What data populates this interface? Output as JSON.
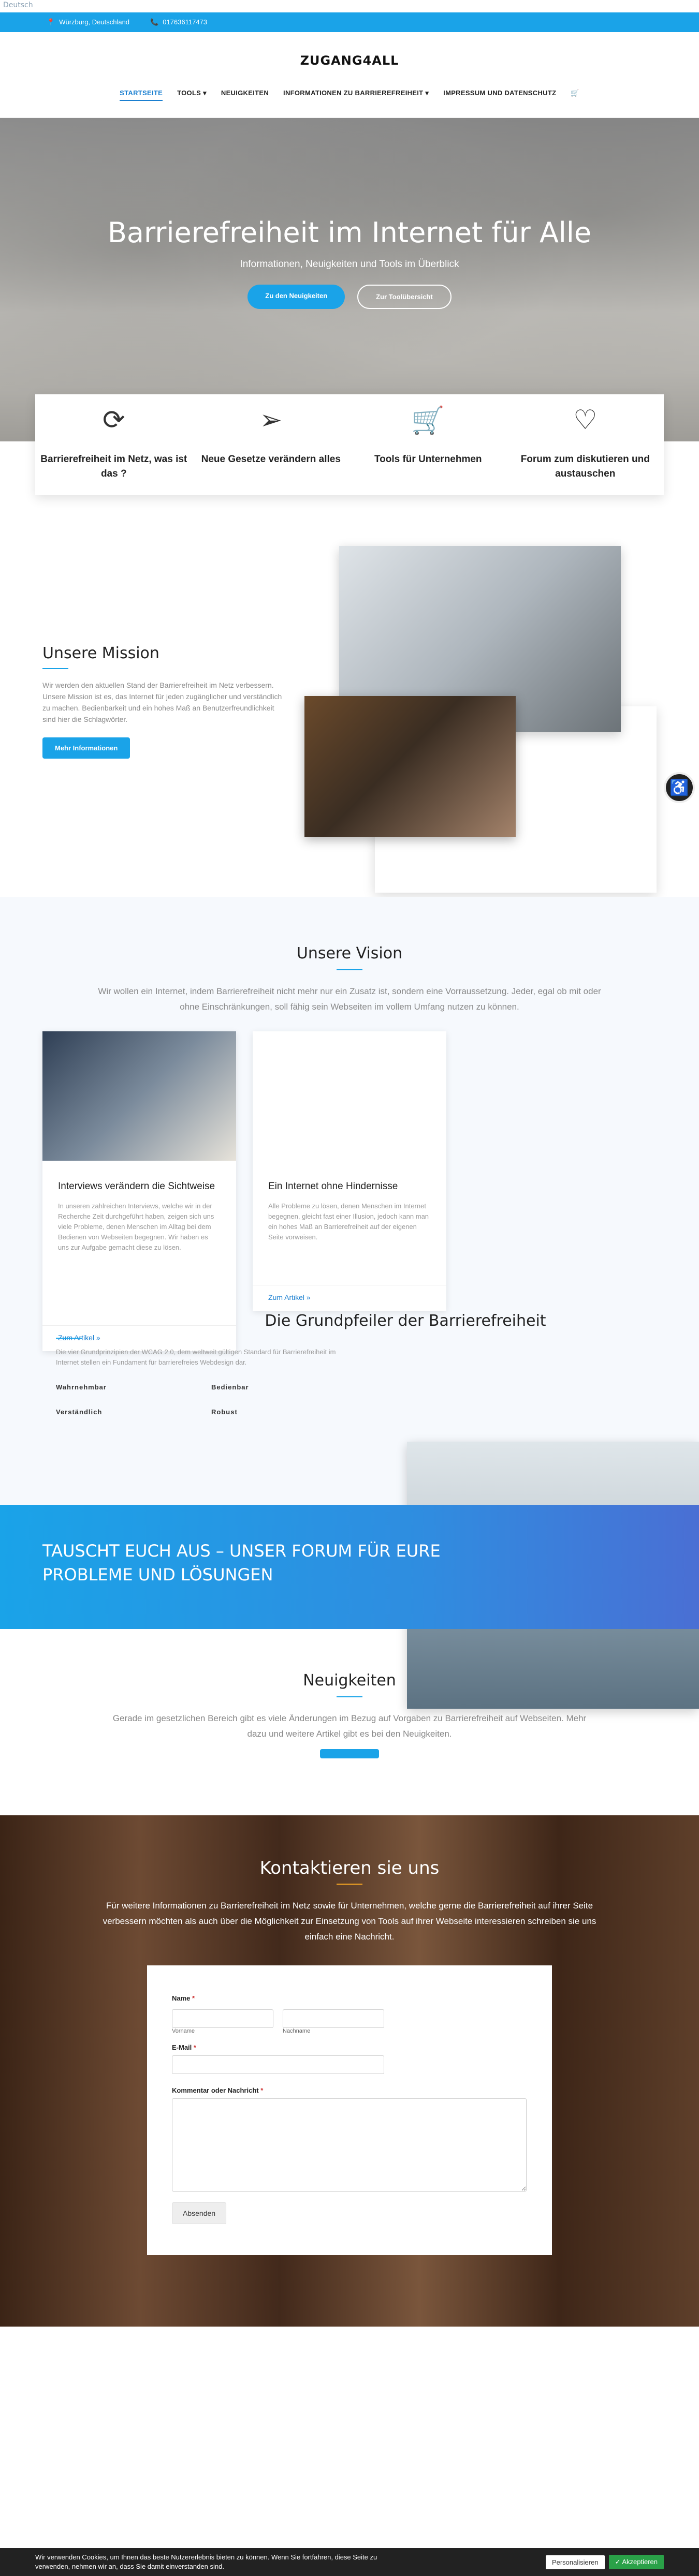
{
  "lang": "Deutsch",
  "topbar": {
    "address": "Würzburg, Deutschland",
    "phone": "017636117473",
    "location_icon": "map-pin-icon",
    "phone_icon": "phone-icon"
  },
  "brand": "ZUGANG4ALL",
  "nav": [
    {
      "label": "Startseite",
      "active": true
    },
    {
      "label": "Tools ▾"
    },
    {
      "label": "Neuigkeiten"
    },
    {
      "label": "Informationen zu Barrierefreiheit ▾"
    },
    {
      "label": "Impressum und Datenschutz"
    }
  ],
  "hero": {
    "title": "Barrierefreiheit im Internet für Alle",
    "subtitle": "Informationen, Neuigkeiten und Tools im Überblick",
    "btn_news": "Zu den Neuigkeiten",
    "btn_tools": "Zur Toolübersicht"
  },
  "features": [
    {
      "icon": "sync-icon",
      "title": "Barrierefreiheit im Netz, was ist das ?"
    },
    {
      "icon": "paper-plane-icon",
      "title": "Neue Gesetze verändern alles"
    },
    {
      "icon": "cart-icon",
      "title": "Tools für Unternehmen"
    },
    {
      "icon": "heart-icon",
      "title": "Forum zum diskutieren und austauschen"
    }
  ],
  "mission": {
    "title": "Unsere Mission",
    "text": "Wir werden den aktuellen Stand der Barrierefreiheit im Netz verbessern. Unsere Mission ist es, das Internet für jeden zugänglicher und verständlich zu machen. Bedienbarkeit und ein hohes Maß an Benutzerfreundlichkeit sind hier die Schlagwörter.",
    "button": "Mehr Informationen"
  },
  "vision": {
    "title": "Unsere Vision",
    "lead": "Wir wollen ein Internet, indem Barrierefreiheit nicht mehr nur ein Zusatz ist, sondern eine Vorraussetzung. Jeder, egal ob mit oder ohne Einschränkungen, soll fähig sein Webseiten im vollem Umfang nutzen zu können.",
    "cards": [
      {
        "title": "Interviews verändern die Sichtweise",
        "text": "In unseren zahlreichen Interviews, welche wir in der Recherche Zeit durchgeführt haben, zeigen sich uns viele Probleme, denen Menschen im Alltag bei dem Bedienen von Webseiten begegnen. Wir haben es uns zur Aufgabe gemacht diese zu lösen.",
        "more": "Zum Artikel »"
      },
      {
        "title": "Ein Internet ohne Hindernisse",
        "text": "Alle Probleme zu lösen, denen Menschen im Internet begegnen, gleicht fast einer Illusion, jedoch kann man ein hohes Maß an Barrierefreiheit auf der eigenen Seite vorweisen.",
        "more": "Zum Artikel »"
      }
    ]
  },
  "pillars": {
    "title": "Die Grundpfeiler der Barrierefreiheit",
    "text": "Die vier Grundprinzipien der WCAG 2.0, dem weltweit gültigen Standard für Barrierefreiheit im Internet stellen ein Fundament für barrierefreies Webdesign dar.",
    "keywords": [
      "Wahrnehmbar",
      "Bedienbar",
      "Verständlich",
      "Robust"
    ]
  },
  "forum": {
    "title": "TAUSCHT EUCH AUS – UNSER FORUM FÜR EURE PROBLEME UND LÖSUNGEN"
  },
  "news": {
    "title": "Neuigkeiten",
    "text": "Gerade im gesetzlichen Bereich gibt es viele Änderungen im Bezug auf Vorgaben zu Barrierefreiheit auf Webseiten. Mehr dazu und weitere Artikel gibt es bei den Neuigkeiten."
  },
  "contact": {
    "title": "Kontaktieren sie uns",
    "lead": "Für weitere Informationen zu Barrierefreiheit im Netz sowie für Unternehmen, welche gerne die Barrierefreiheit auf ihrer Seite verbessern möchten als auch über die Möglichkeit zur Einsetzung von Tools auf ihrer Webseite interessieren schreiben sie uns einfach eine Nachricht.",
    "name_label": "Name",
    "first": "Vorname",
    "last": "Nachname",
    "email_label": "E-Mail",
    "message_label": "Kommentar oder Nachricht",
    "submit": "Absenden"
  },
  "cookie": {
    "text": "Wir verwenden Cookies, um Ihnen das beste Nutzererlebnis bieten zu können. Wenn Sie fortfahren, diese Seite zu verwenden, nehmen wir an, dass Sie damit einverstanden sind.",
    "personalize": "Personalisieren",
    "accept": "✓ Akzeptieren"
  }
}
